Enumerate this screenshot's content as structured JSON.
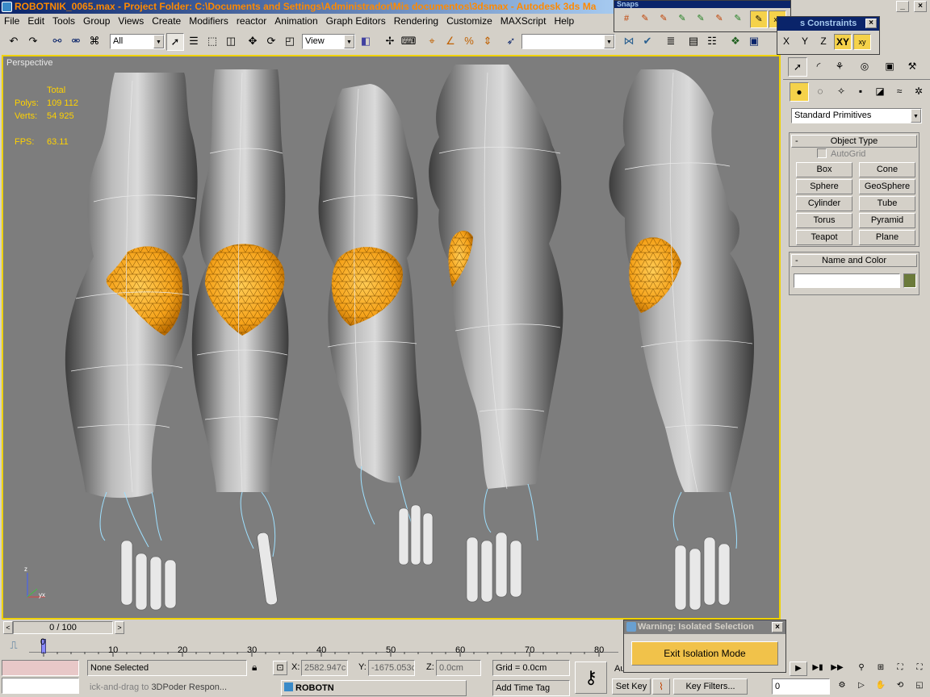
{
  "window": {
    "title": "ROBOTNIK_0065.max     - Project Folder: C:\\Documents and Settings\\Administrador\\Mis documentos\\3dsmax     - Autodesk 3ds Ma",
    "minimize": "_",
    "close": "×"
  },
  "menu": [
    "File",
    "Edit",
    "Tools",
    "Group",
    "Views",
    "Create",
    "Modifiers",
    "reactor",
    "Animation",
    "Graph Editors",
    "Rendering",
    "Customize",
    "MAXScript",
    "Help"
  ],
  "toolbar": {
    "selection_filter": "All",
    "ref_coord": "View"
  },
  "snaps": {
    "title": "Snaps"
  },
  "axis_constraints": {
    "title": "s Constraints",
    "x": "X",
    "y": "Y",
    "z": "Z",
    "xy": "XY"
  },
  "viewport": {
    "label": "Perspective",
    "stats": {
      "total_label": "Total",
      "polys_label": "Polys:",
      "polys": "109 112",
      "verts_label": "Verts:",
      "verts": "54 925",
      "fps_label": "FPS:",
      "fps": "63.11"
    }
  },
  "command_panel": {
    "category": "Standard Primitives",
    "object_type_title": "Object Type",
    "autogrid": "AutoGrid",
    "buttons": [
      "Box",
      "Cone",
      "Sphere",
      "GeoSphere",
      "Cylinder",
      "Tube",
      "Torus",
      "Pyramid",
      "Teapot",
      "Plane"
    ],
    "name_color_title": "Name and Color",
    "object_name": "",
    "object_color": "#6b7a3a",
    "rollout_collapse": "-"
  },
  "timeline": {
    "frame_display": "0 / 100",
    "ticks": [
      "0",
      "10",
      "20",
      "30",
      "40",
      "50",
      "60",
      "70",
      "80"
    ]
  },
  "status": {
    "selection": "None Selected",
    "x_label": "X:",
    "x_value": "2582.947c",
    "y_label": "Y:",
    "y_value": "-1675.053c",
    "z_label": "Z:",
    "z_value": "0.0cm",
    "grid": "Grid = 0.0cm",
    "prompt": "ick-and-drag to",
    "add_time_tag": "Add Time Tag",
    "set_key": "Set Key",
    "key_filters": "Key Filters...",
    "frame_field": "0",
    "auto_key_partial": "Au",
    "taskbar_item1": "3DPoder",
    "taskbar_item2": "Respon...",
    "taskbar_item3": "ROBOTN"
  },
  "warning_dialog": {
    "title": "Warning: Isolated Selection",
    "button": "Exit Isolation Mode",
    "close": "×"
  },
  "colors": {
    "selection_orange": "#f5a21a",
    "viewport_border": "#f0d200",
    "viewport_bg": "#7d7d7d",
    "stats_yellow": "#ffd200",
    "spline_cyan": "#9ee0ff"
  }
}
